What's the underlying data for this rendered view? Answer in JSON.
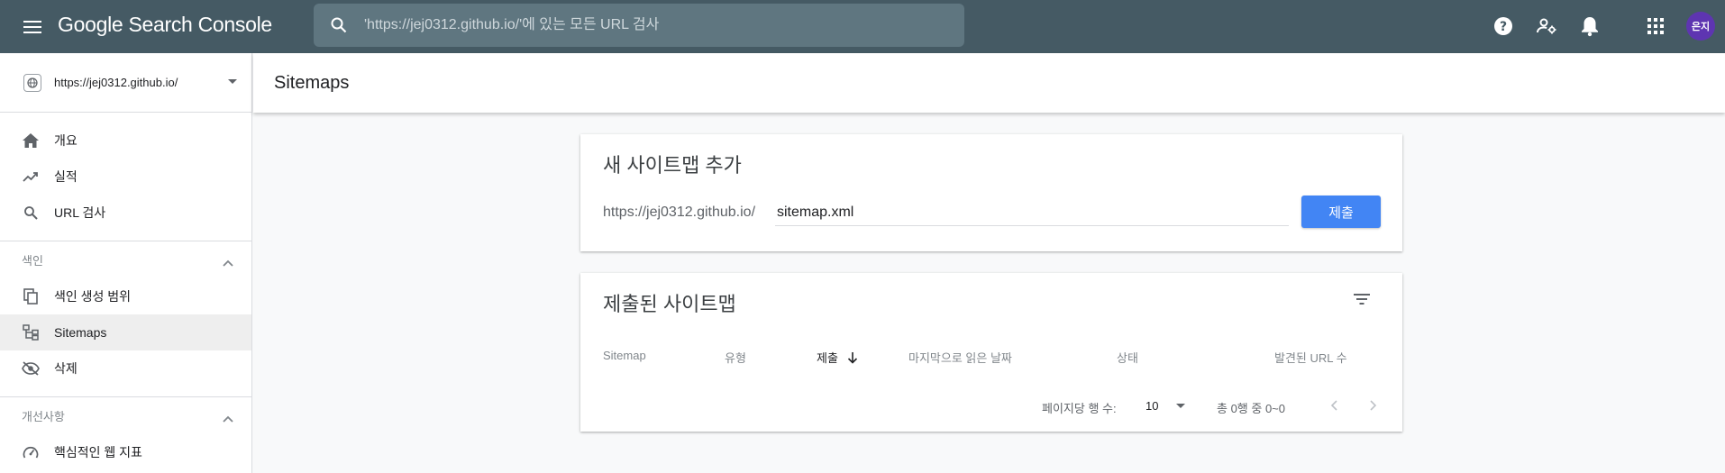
{
  "app": {
    "title": "Google Search Console"
  },
  "search": {
    "placeholder": "'https://jej0312.github.io/'에 있는 모든 URL 검사"
  },
  "topbar_icons": [
    "menu-icon",
    "search-icon",
    "help-icon",
    "manage-users-icon",
    "notifications-icon",
    "apps-icon"
  ],
  "user": {
    "avatar_text": "은지"
  },
  "property": {
    "url": "https://jej0312.github.io/"
  },
  "sidebar": {
    "items": [
      {
        "label": "개요",
        "icon": "home-icon"
      },
      {
        "label": "실적",
        "icon": "trending-up-icon"
      },
      {
        "label": "URL 검사",
        "icon": "search-icon"
      }
    ],
    "index_group": {
      "label": "색인"
    },
    "index_items": [
      {
        "label": "색인 생성 범위",
        "icon": "copy-icon"
      },
      {
        "label": "Sitemaps",
        "icon": "sitemap-icon",
        "active": true
      },
      {
        "label": "삭제",
        "icon": "visibility-off-icon"
      }
    ],
    "enhance_group": {
      "label": "개선사항"
    },
    "enhance_items": [
      {
        "label": "핵심적인 웹 지표",
        "icon": "speed-icon"
      }
    ]
  },
  "page": {
    "title": "Sitemaps"
  },
  "add_sitemap": {
    "title": "새 사이트맵 추가",
    "prefix": "https://jej0312.github.io/",
    "input_value": "sitemap.xml",
    "submit_label": "제출"
  },
  "submitted": {
    "title": "제출된 사이트맵",
    "columns": [
      "Sitemap",
      "유형",
      "제출",
      "마지막으로 읽은 날짜",
      "상태",
      "발견된 URL 수"
    ],
    "sorted_column": "제출",
    "rows": [],
    "pagination": {
      "rows_per_page_label": "페이지당 행 수:",
      "rows_per_page": "10",
      "range": "총 0행 중 0~0"
    }
  },
  "colors": {
    "topbar": "#455a64",
    "accent": "#4285f4",
    "avatar": "#5e35b1"
  }
}
